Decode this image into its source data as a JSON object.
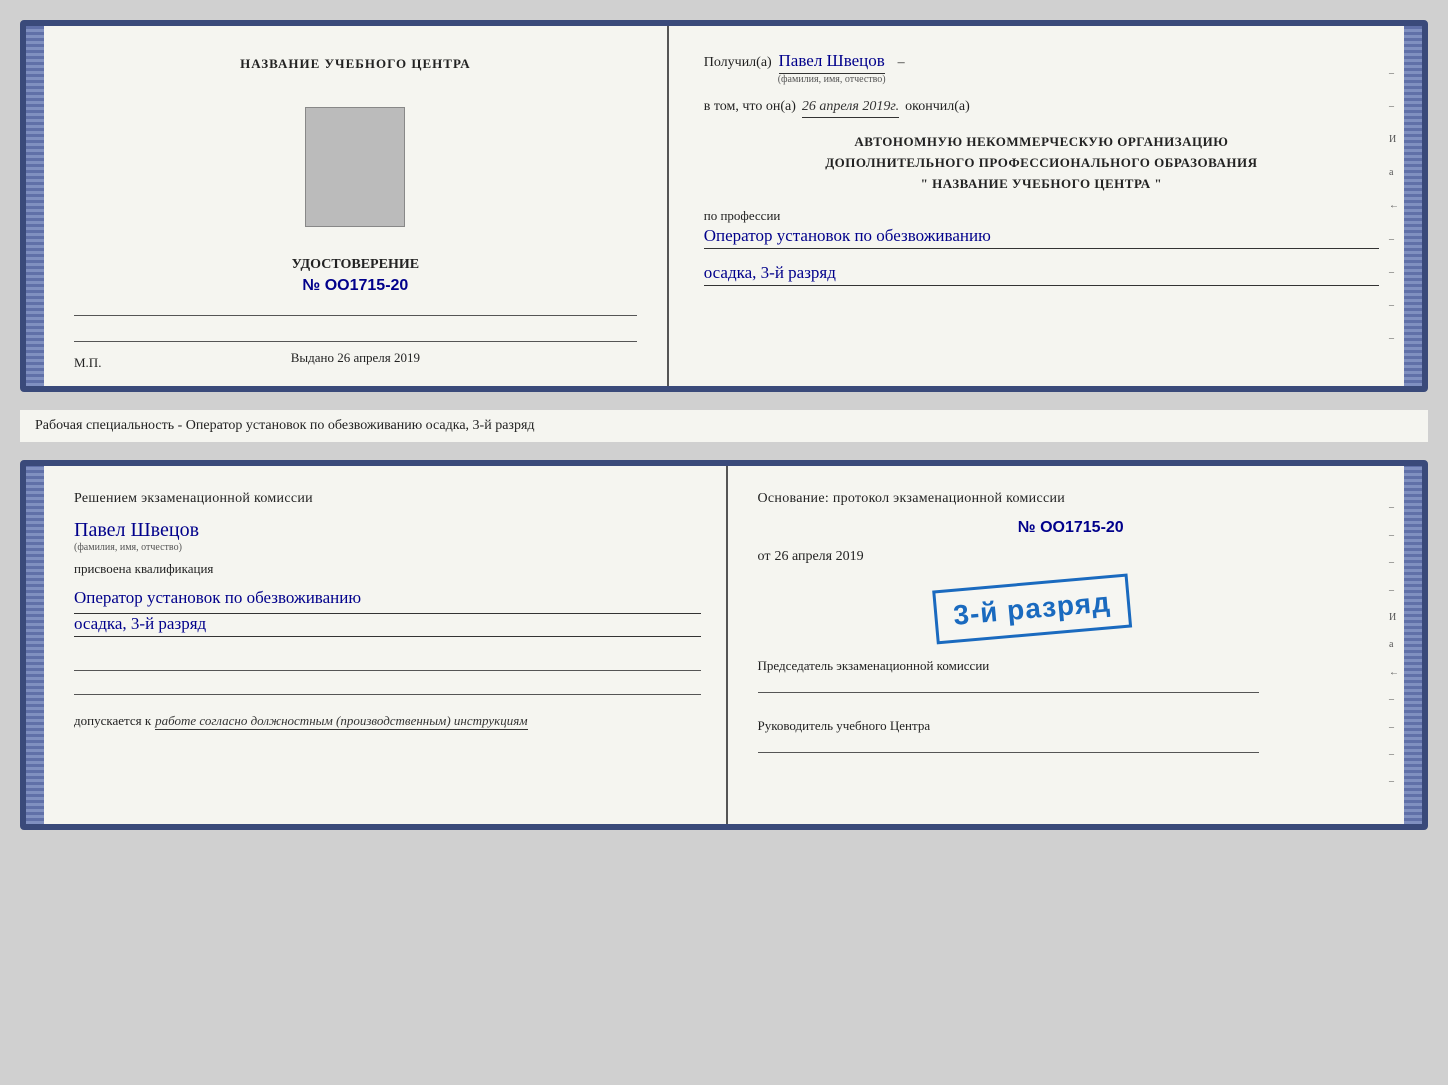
{
  "doc1": {
    "left": {
      "center_name": "НАЗВАНИЕ УЧЕБНОГО ЦЕНТРА",
      "cert_title": "УДОСТОВЕРЕНИЕ",
      "cert_number": "№ OO1715-20",
      "issued_label": "Выдано",
      "issued_date": "26 апреля 2019",
      "mp_label": "М.П."
    },
    "right": {
      "received_label": "Получил(а)",
      "received_name": "Павел Швецов",
      "fio_label": "(фамилия, имя, отчество)",
      "inthat_label": "в том, что он(а)",
      "date_value": "26 апреля 2019г.",
      "finished_label": "окончил(а)",
      "org_line1": "АВТОНОМНУЮ НЕКОММЕРЧЕСКУЮ ОРГАНИЗАЦИЮ",
      "org_line2": "ДОПОЛНИТЕЛЬНОГО ПРОФЕССИОНАЛЬНОГО ОБРАЗОВАНИЯ",
      "org_line3": "\"  НАЗВАНИЕ УЧЕБНОГО ЦЕНТРА  \"",
      "profession_label": "по профессии",
      "profession_value": "Оператор установок по обезвоживанию",
      "grade_value": "осадка, 3-й разряд",
      "edge_letters": "И а ←"
    }
  },
  "middle_label": "Рабочая специальность - Оператор установок по обезвоживанию осадка, 3-й разряд",
  "doc2": {
    "left": {
      "commission_title": "Решением  экзаменационной  комиссии",
      "person_name": "Павел Швецов",
      "fio_label": "(фамилия, имя, отчество)",
      "qualification_label": "присвоена квалификация",
      "qualification_value": "Оператор установок по обезвоживанию",
      "grade_value": "осадка, 3-й разряд",
      "допускается_label": "допускается к",
      "допускается_value": "работе согласно должностным (производственным) инструкциям"
    },
    "right": {
      "basis_label": "Основание: протокол экзаменационной  комиссии",
      "protocol_number": "№  OO1715-20",
      "from_label": "от",
      "from_date": "26 апреля 2019",
      "chairman_label": "Председатель экзаменационной комиссии",
      "head_label": "Руководитель учебного Центра",
      "edge_letters": "И а ←"
    },
    "stamp": {
      "text": "3-й разряд"
    }
  }
}
